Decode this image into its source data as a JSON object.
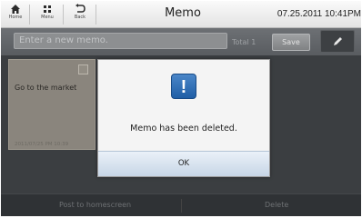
{
  "topbar": {
    "home_label": "Home",
    "menu_label": "Menu",
    "back_label": "Back",
    "title": "Memo",
    "datetime": "07.25.2011 10:41PM"
  },
  "input_row": {
    "placeholder": "Enter a new memo.",
    "total": "Total 1",
    "save_label": "Save",
    "pen_icon": "pen-icon"
  },
  "note": {
    "text": "Go to the market",
    "date": "2011/07/25 PM 10:39"
  },
  "dialog": {
    "icon": "exclamation-icon",
    "message": "Memo has been deleted.",
    "ok_label": "OK"
  },
  "bottombar": {
    "post_label": "Post to homescreen",
    "delete_label": "Delete"
  },
  "colors": {
    "accent": "#2f6db5",
    "dark_bg": "#3b3e41"
  }
}
